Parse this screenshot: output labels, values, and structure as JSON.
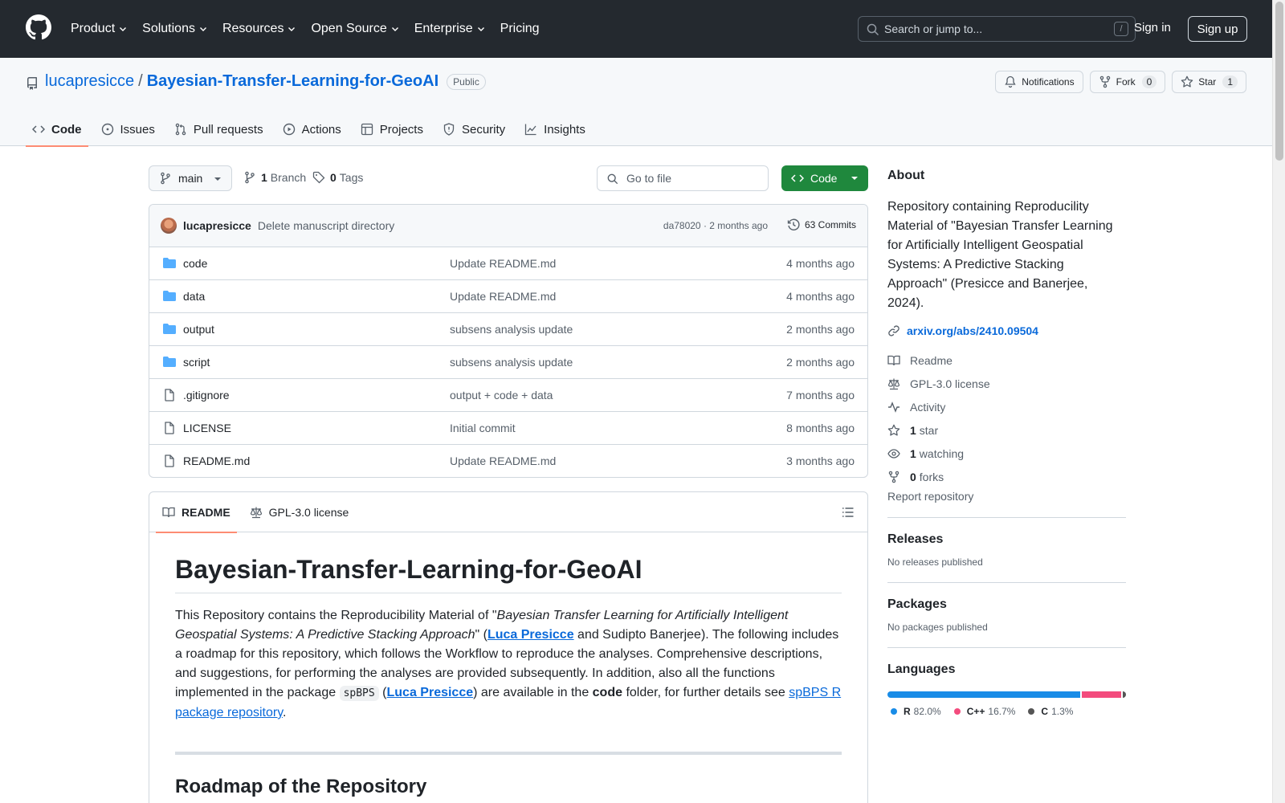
{
  "header": {
    "nav": [
      {
        "label": "Product",
        "has_menu": true
      },
      {
        "label": "Solutions",
        "has_menu": true
      },
      {
        "label": "Resources",
        "has_menu": true
      },
      {
        "label": "Open Source",
        "has_menu": true
      },
      {
        "label": "Enterprise",
        "has_menu": true
      },
      {
        "label": "Pricing",
        "has_menu": false
      }
    ],
    "search_placeholder": "Search or jump to...",
    "search_shortcut": "/",
    "sign_in": "Sign in",
    "sign_up": "Sign up"
  },
  "repo": {
    "owner": "lucapresicce",
    "separator": "/",
    "name": "Bayesian-Transfer-Learning-for-GeoAI",
    "visibility": "Public",
    "notifications_label": "Notifications",
    "fork_label": "Fork",
    "fork_count": "0",
    "star_label": "Star",
    "star_count": "1"
  },
  "tabs": [
    {
      "label": "Code",
      "icon": "code-icon",
      "active": true
    },
    {
      "label": "Issues",
      "icon": "issue-icon",
      "active": false
    },
    {
      "label": "Pull requests",
      "icon": "pull-request-icon",
      "active": false
    },
    {
      "label": "Actions",
      "icon": "play-icon",
      "active": false
    },
    {
      "label": "Projects",
      "icon": "table-icon",
      "active": false
    },
    {
      "label": "Security",
      "icon": "shield-icon",
      "active": false
    },
    {
      "label": "Insights",
      "icon": "graph-icon",
      "active": false
    }
  ],
  "browser": {
    "branch": "main",
    "branch_count": "1",
    "branch_label": "Branch",
    "tag_count": "0",
    "tag_label": "Tags",
    "goto_placeholder": "Go to file",
    "code_button": "Code",
    "commit": {
      "author": "lucapresicce",
      "message": "Delete manuscript directory",
      "sha_time": "da78020 · 2 months ago",
      "commits": "63 Commits"
    },
    "files": [
      {
        "name": "code",
        "type": "folder",
        "message": "Update README.md",
        "date": "4 months ago"
      },
      {
        "name": "data",
        "type": "folder",
        "message": "Update README.md",
        "date": "4 months ago"
      },
      {
        "name": "output",
        "type": "folder",
        "message": "subsens analysis update",
        "date": "2 months ago"
      },
      {
        "name": "script",
        "type": "folder",
        "message": "subsens analysis update",
        "date": "2 months ago"
      },
      {
        "name": ".gitignore",
        "type": "file",
        "message": "output + code + data",
        "date": "7 months ago"
      },
      {
        "name": "LICENSE",
        "type": "file",
        "message": "Initial commit",
        "date": "8 months ago"
      },
      {
        "name": "README.md",
        "type": "file",
        "message": "Update README.md",
        "date": "3 months ago"
      }
    ]
  },
  "readme": {
    "tab_readme": "README",
    "tab_license": "GPL-3.0 license",
    "title": "Bayesian-Transfer-Learning-for-GeoAI",
    "p1_a": "This Repository contains the Reproducibility Material of \"",
    "p1_italic": "Bayesian Transfer Learning for Artificially Intelligent Geospatial Systems: A Predictive Stacking Approach",
    "p1_b": "\" (",
    "p1_link1": "Luca Presicce",
    "p1_c": " and Sudipto Banerjee). The following includes a roadmap for this repository, which follows the Workflow to reproduce the analyses. Comprehensive descriptions, and suggestions, for performing the analyses are provided subsequently. In addition, also all the functions implemented in the package ",
    "p1_code": "spBPS",
    "p1_d": " (",
    "p1_link2": "Luca Presicce",
    "p1_e": ") are available in the ",
    "p1_bold": "code",
    "p1_f": " folder, for further details see ",
    "p1_link3": "spBPS R package repository",
    "p1_g": ".",
    "h2": "Roadmap of the Repository"
  },
  "sidebar": {
    "about_title": "About",
    "description": "Repository containing Reproducility Material of \"Bayesian Transfer Learning for Artificially Intelligent Geospatial Systems: A Predictive Stacking Approach\" (Presicce and Banerjee, 2024).",
    "homepage": "arxiv.org/abs/2410.09504",
    "readme": "Readme",
    "license": "GPL-3.0 license",
    "activity": "Activity",
    "stars_count": "1",
    "stars_label": "star",
    "watching_count": "1",
    "watching_label": "watching",
    "forks_count": "0",
    "forks_label": "forks",
    "report": "Report repository",
    "releases_title": "Releases",
    "releases_text": "No releases published",
    "packages_title": "Packages",
    "packages_text": "No packages published",
    "languages_title": "Languages",
    "languages": [
      {
        "name": "R",
        "percent": 82.0,
        "label": "82.0%",
        "color": "#198CE7"
      },
      {
        "name": "C++",
        "percent": 16.7,
        "label": "16.7%",
        "color": "#F34B7D"
      },
      {
        "name": "C",
        "percent": 1.3,
        "label": "1.3%",
        "color": "#555555"
      }
    ]
  }
}
